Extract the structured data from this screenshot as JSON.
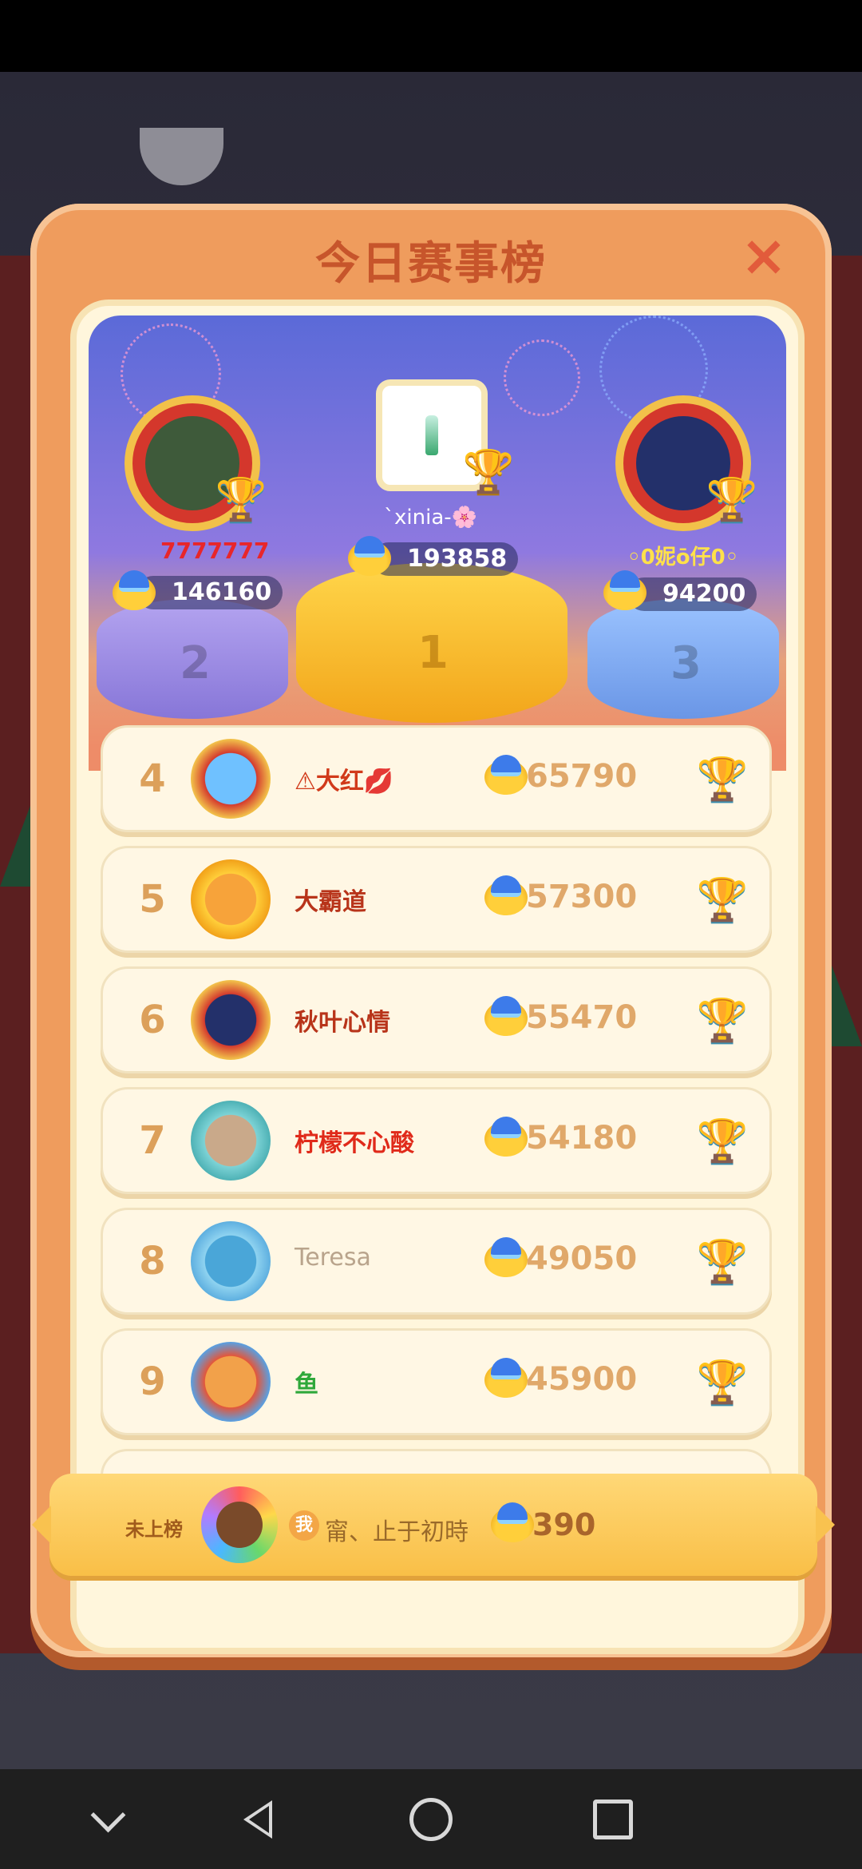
{
  "header": {
    "title": "今日赛事榜",
    "close_icon": "×"
  },
  "podium": {
    "first": {
      "rank": "1",
      "name": "`xinia-🌸",
      "score": "193858"
    },
    "second": {
      "rank": "2",
      "name": "7777777",
      "score": "146160"
    },
    "third": {
      "rank": "3",
      "name": "◦0妮ō仔0◦",
      "score": "94200"
    }
  },
  "ranking": [
    {
      "rank": "4",
      "name": "⚠大红💋",
      "score": "65790",
      "name_color": "#d13a1a"
    },
    {
      "rank": "5",
      "name": "大霸道",
      "score": "57300",
      "name_color": "#b8341a"
    },
    {
      "rank": "6",
      "name": "秋叶心情",
      "score": "55470",
      "name_color": "#b8341a"
    },
    {
      "rank": "7",
      "name": "柠檬不心酸",
      "score": "54180",
      "name_color": "#e02a1a"
    },
    {
      "rank": "8",
      "name": "Teresa",
      "score": "49050",
      "name_color": "#b9a48c"
    },
    {
      "rank": "9",
      "name": "鱼",
      "score": "45900",
      "name_color": "#2fa83a"
    }
  ],
  "self": {
    "label": "未上榜",
    "badge": "我",
    "name": "甯、止于初時",
    "score": "390"
  },
  "colors": {
    "modal_bg": "#ef9c5d",
    "title": "#c7552b",
    "panel_bg": "#fff6dc",
    "rank_number": "#dca05a",
    "score": "#e0a86a"
  },
  "icons": [
    "close-icon",
    "trophy-icon",
    "coin-icon",
    "bottle-icon",
    "back-icon",
    "home-icon",
    "recents-icon",
    "collapse-icon"
  ]
}
